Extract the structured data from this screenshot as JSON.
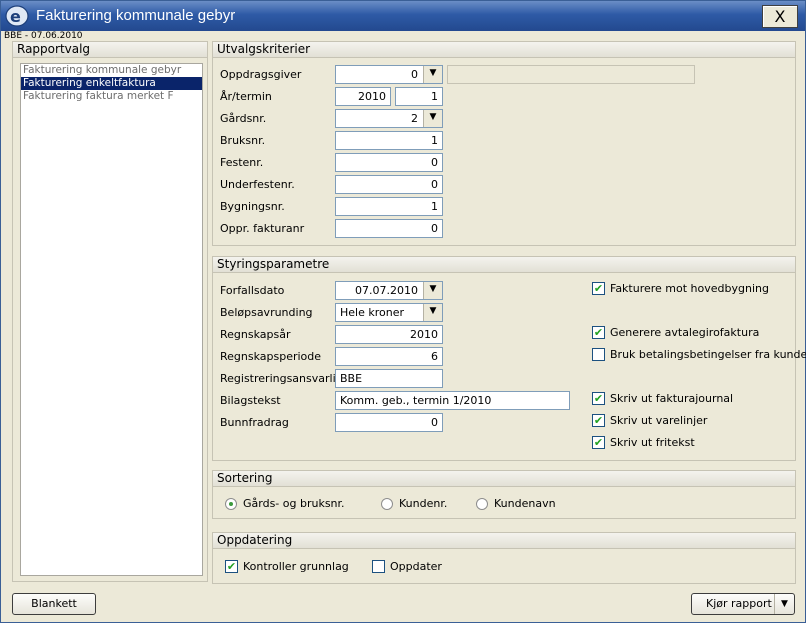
{
  "window": {
    "title": "Fakturering kommunale gebyr",
    "subtitle": "BBE - 07.06.2010",
    "close_label": "X"
  },
  "rapportvalg": {
    "header": "Rapportvalg",
    "items": [
      {
        "label": "Fakturering kommunale gebyr"
      },
      {
        "label": "Fakturering enkeltfaktura"
      },
      {
        "label": "Fakturering faktura merket F"
      }
    ],
    "selected_index": 1
  },
  "utvalg": {
    "header": "Utvalgskriterier",
    "oppdragsgiver_label": "Oppdragsgiver",
    "oppdragsgiver_value": "0",
    "oppdragsgiver_name": "",
    "aar_termin_label": "År/termin",
    "aar_value": "2010",
    "termin_value": "1",
    "gardsnr_label": "Gårdsnr.",
    "gardsnr_value": "2",
    "bruksnr_label": "Bruksnr.",
    "bruksnr_value": "1",
    "festenr_label": "Festenr.",
    "festenr_value": "0",
    "underfestenr_label": "Underfestenr.",
    "underfestenr_value": "0",
    "bygningsnr_label": "Bygningsnr.",
    "bygningsnr_value": "1",
    "oppr_fakturanr_label": "Oppr. fakturanr",
    "oppr_fakturanr_value": "0"
  },
  "styring": {
    "header": "Styringsparametre",
    "forfallsdato_label": "Forfallsdato",
    "forfallsdato_value": "07.07.2010",
    "belopsavrunding_label": "Beløpsavrunding",
    "belopsavrunding_value": "Hele kroner",
    "regnskapsaar_label": "Regnskapsår",
    "regnskapsaar_value": "2010",
    "regnskapsperiode_label": "Regnskapsperiode",
    "regnskapsperiode_value": "6",
    "registreringsansvarlig_label": "Registreringsansvarlig",
    "registreringsansvarlig_value": "BBE",
    "bilagstekst_label": "Bilagstekst",
    "bilagstekst_value": "Komm. geb., termin 1/2010",
    "bunnfradrag_label": "Bunnfradrag",
    "bunnfradrag_value": "0",
    "checkboxes": {
      "hovedbygning": {
        "label": "Fakturere mot hovedbygning",
        "checked": true
      },
      "avtalegiro": {
        "label": "Generere avtalegirofaktura",
        "checked": true
      },
      "betalingsbetingelser": {
        "label": "Bruk betalingsbetingelser fra kunde",
        "checked": false
      },
      "fakturajournal": {
        "label": "Skriv ut fakturajournal",
        "checked": true
      },
      "varelinjer": {
        "label": "Skriv ut varelinjer",
        "checked": true
      },
      "fritekst": {
        "label": "Skriv ut fritekst",
        "checked": true
      }
    }
  },
  "sortering": {
    "header": "Sortering",
    "options": [
      {
        "label": "Gårds- og bruksnr.",
        "selected": true
      },
      {
        "label": "Kundenr.",
        "selected": false
      },
      {
        "label": "Kundenavn",
        "selected": false
      }
    ]
  },
  "oppdatering": {
    "header": "Oppdatering",
    "kontroller": {
      "label": "Kontroller grunnlag",
      "checked": true
    },
    "oppdater": {
      "label": "Oppdater",
      "checked": false
    }
  },
  "buttons": {
    "blankett": "Blankett",
    "kjor_rapport": "Kjør rapport"
  },
  "colors": {
    "titlebar": "#2e5aa6",
    "selection": "#0a246a",
    "background": "#ece9d8"
  }
}
